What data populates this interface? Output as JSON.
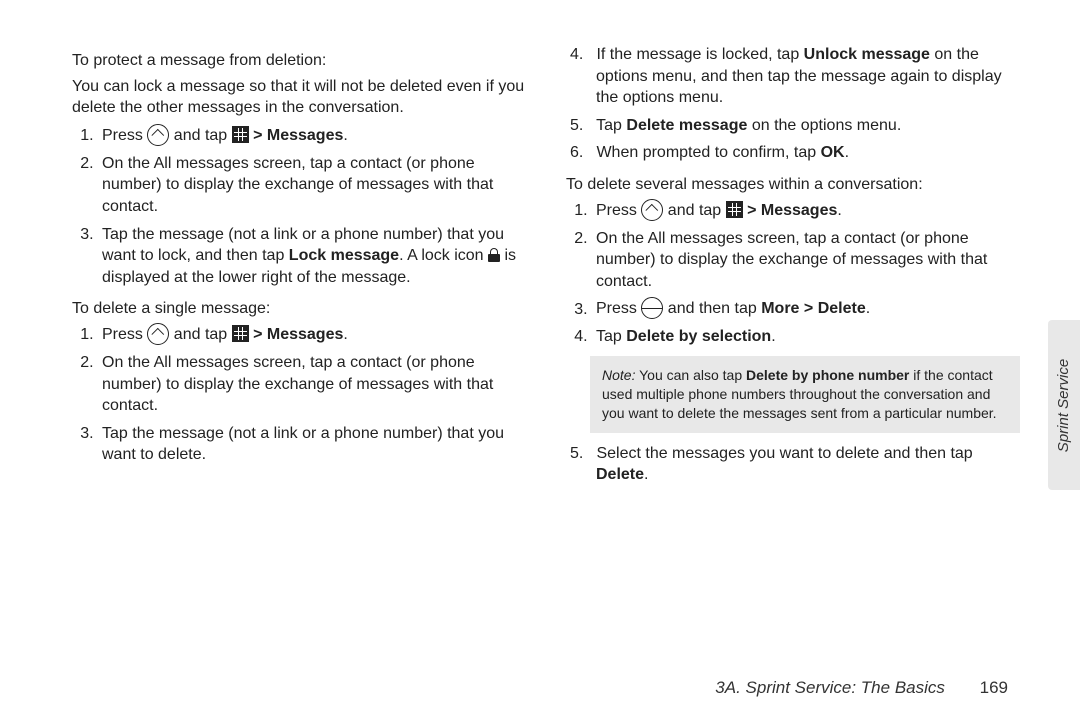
{
  "left": {
    "h1": "To protect a message from deletion:",
    "p1": "You can lock a message so that it will not be deleted even if you delete the other messages in the conversation.",
    "a": {
      "s1a": "Press ",
      "s1b": " and tap ",
      "s1c": " > ",
      "s1d": "Messages",
      "s1e": ".",
      "s2": "On the All messages screen, tap a contact (or phone number) to display the exchange of messages with that contact.",
      "s3a": "Tap the message (not a link or a phone number) that you want to lock, and then tap ",
      "s3b": "Lock message",
      "s3c": ". A lock icon ",
      "s3d": " is displayed at the lower right of the message."
    },
    "h2": "To delete a single message:",
    "b": {
      "s1a": "Press ",
      "s1b": " and tap ",
      "s1c": " > ",
      "s1d": "Messages",
      "s1e": ".",
      "s2": "On the All messages screen, tap a contact (or phone number) to display the exchange of messages with that contact.",
      "s3": "Tap the message (not a link or a phone number) that you want to delete."
    }
  },
  "right": {
    "c": {
      "s4a": "If the message is locked, tap ",
      "s4b": "Unlock message",
      "s4c": " on the options menu, and then tap the message again to display the options menu.",
      "s5a": "Tap ",
      "s5b": "Delete message",
      "s5c": " on the options menu.",
      "s6a": "When prompted to confirm, tap ",
      "s6b": "OK",
      "s6c": "."
    },
    "h3": "To delete several messages within a conversation:",
    "d": {
      "s1a": "Press ",
      "s1b": " and tap ",
      "s1c": " > ",
      "s1d": "Messages",
      "s1e": ".",
      "s2": "On the All messages screen, tap a contact (or phone number) to display the exchange of messages with that contact.",
      "s3a": "Press ",
      "s3b": " and then tap ",
      "s3c": "More",
      "s3d": " > ",
      "s3e": "Delete",
      "s3f": ".",
      "s4a": "Tap ",
      "s4b": "Delete by selection",
      "s4c": "."
    },
    "note": {
      "label": "Note:",
      "t1": " You can also tap ",
      "t2": "Delete by phone number",
      "t3": " if the contact used multiple phone numbers throughout the conversation and you want to delete the messages sent from a particular number."
    },
    "d2": {
      "s5a": "Select the messages you want to delete and then tap ",
      "s5b": "Delete",
      "s5c": "."
    }
  },
  "sideTab": "Sprint Service",
  "footer": {
    "title": "3A. Sprint Service: The Basics",
    "page": "169"
  }
}
